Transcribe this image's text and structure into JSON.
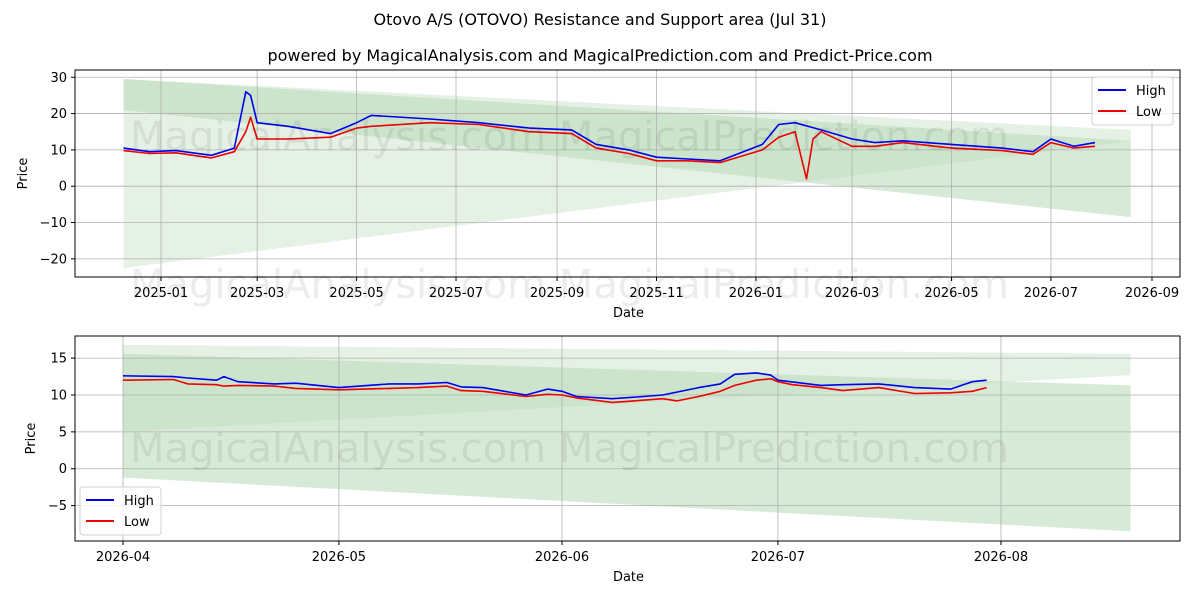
{
  "page": {
    "title": "Otovo A/S (OTOVO) Resistance and Support area (Jul 31)",
    "subtitle": "powered by MagicalAnalysis.com and MagicalPrediction.com and Predict-Price.com",
    "watermark_top": "MagicalAnalysis.com    MagicalPrediction.com",
    "watermark_middle": "MagicalAnalysis.com    MagicalPrediction.com",
    "watermark_bottom": "MagicalAnalysis.com    MagicalPrediction.com"
  },
  "colors": {
    "high": "#0000ee",
    "low": "#ee0000",
    "band_light": "#e3f0e3",
    "band_mid": "#cfe6cf",
    "band_dark": "#b6d9b6"
  },
  "chart_data": [
    {
      "type": "line",
      "xlabel": "Date",
      "ylabel": "Price",
      "x_ticks": [
        "2025-01",
        "2025-03",
        "2025-05",
        "2025-07",
        "2025-09",
        "2025-11",
        "2026-01",
        "2026-03",
        "2026-05",
        "2026-07",
        "2026-09"
      ],
      "y_ticks": [
        "30",
        "20",
        "10",
        "0",
        "−10",
        "−20"
      ],
      "ylim": [
        -25,
        32
      ],
      "grid": true,
      "legend": {
        "position": "top-right",
        "entries": [
          "High",
          "Low"
        ]
      },
      "bands": [
        {
          "name": "support-resistance-wide",
          "x_start": "2024-12-09",
          "x_end": "2026-08-19",
          "upper": [
            29.5,
            15.5
          ],
          "lower": [
            -22.5,
            12.5
          ]
        },
        {
          "name": "support-resistance-inner",
          "x_start": "2024-12-09",
          "x_end": "2026-08-19",
          "upper": [
            29.5,
            12.5
          ],
          "lower": [
            21.0,
            -8.5
          ]
        }
      ],
      "series": [
        {
          "name": "High",
          "x": [
            "2024-12-09",
            "2024-12-25",
            "2025-01-10",
            "2025-02-01",
            "2025-02-15",
            "2025-02-22",
            "2025-02-25",
            "2025-03-01",
            "2025-03-20",
            "2025-04-15",
            "2025-05-01",
            "2025-05-10",
            "2025-06-15",
            "2025-07-15",
            "2025-08-15",
            "2025-09-10",
            "2025-09-25",
            "2025-10-15",
            "2025-11-01",
            "2025-11-20",
            "2025-12-10",
            "2026-01-05",
            "2026-01-15",
            "2026-01-25",
            "2026-02-10",
            "2026-03-01",
            "2026-03-15",
            "2026-04-01",
            "2026-05-01",
            "2026-06-01",
            "2026-06-20",
            "2026-07-01",
            "2026-07-15",
            "2026-07-28"
          ],
          "y": [
            10.5,
            9.5,
            9.8,
            8.5,
            10.5,
            26.0,
            25.0,
            17.5,
            16.5,
            14.5,
            17.5,
            19.5,
            18.5,
            17.5,
            16.0,
            15.5,
            11.5,
            10.0,
            8.0,
            7.5,
            7.0,
            11.5,
            17.0,
            17.5,
            15.5,
            13.0,
            12.0,
            12.5,
            11.5,
            10.5,
            9.5,
            13.0,
            11.0,
            12.0
          ]
        },
        {
          "name": "Low",
          "x": [
            "2024-12-09",
            "2024-12-25",
            "2025-01-10",
            "2025-02-01",
            "2025-02-15",
            "2025-02-22",
            "2025-02-25",
            "2025-03-01",
            "2025-03-20",
            "2025-04-15",
            "2025-05-01",
            "2025-05-10",
            "2025-06-15",
            "2025-07-15",
            "2025-08-15",
            "2025-09-10",
            "2025-09-25",
            "2025-10-15",
            "2025-11-01",
            "2025-11-20",
            "2025-12-10",
            "2026-01-05",
            "2026-01-15",
            "2026-01-25",
            "2026-02-01",
            "2026-02-05",
            "2026-02-10",
            "2026-03-01",
            "2026-03-15",
            "2026-04-01",
            "2026-05-01",
            "2026-06-01",
            "2026-06-20",
            "2026-07-01",
            "2026-07-15",
            "2026-07-28"
          ],
          "y": [
            9.8,
            9.0,
            9.2,
            7.8,
            9.5,
            15.0,
            19.0,
            13.0,
            13.0,
            13.5,
            16.0,
            16.5,
            17.5,
            17.0,
            15.0,
            14.5,
            10.5,
            9.0,
            7.0,
            7.0,
            6.5,
            10.0,
            13.5,
            15.0,
            2.0,
            13.0,
            15.0,
            11.0,
            11.0,
            12.0,
            10.5,
            9.8,
            8.8,
            12.0,
            10.5,
            11.0
          ]
        }
      ]
    },
    {
      "type": "line",
      "xlabel": "Date",
      "ylabel": "Price",
      "x_ticks": [
        "2026-04",
        "2026-05",
        "2026-06",
        "2026-07",
        "2026-08"
      ],
      "y_ticks": [
        "15",
        "10",
        "5",
        "0",
        "−5"
      ],
      "ylim": [
        -9.8,
        18
      ],
      "grid": true,
      "legend": {
        "position": "bottom-left",
        "entries": [
          "High",
          "Low"
        ]
      },
      "bands": [
        {
          "name": "support-resistance-wide",
          "x_start": "2026-04-01",
          "x_end": "2026-08-19",
          "upper": [
            16.8,
            15.6
          ],
          "lower": [
            5.0,
            12.7
          ]
        },
        {
          "name": "support-resistance-inner",
          "x_start": "2026-04-01",
          "x_end": "2026-08-19",
          "upper": [
            15.6,
            11.3
          ],
          "lower": [
            -1.2,
            -8.5
          ]
        }
      ],
      "series": [
        {
          "name": "High",
          "x": [
            "2026-04-01",
            "2026-04-08",
            "2026-04-10",
            "2026-04-14",
            "2026-04-15",
            "2026-04-17",
            "2026-04-22",
            "2026-04-25",
            "2026-05-01",
            "2026-05-08",
            "2026-05-12",
            "2026-05-16",
            "2026-05-18",
            "2026-05-21",
            "2026-05-27",
            "2026-05-30",
            "2026-06-01",
            "2026-06-03",
            "2026-06-08",
            "2026-06-11",
            "2026-06-15",
            "2026-06-20",
            "2026-06-23",
            "2026-06-25",
            "2026-06-28",
            "2026-06-30",
            "2026-07-01",
            "2026-07-07",
            "2026-07-10",
            "2026-07-15",
            "2026-07-20",
            "2026-07-25",
            "2026-07-28",
            "2026-07-30"
          ],
          "y": [
            12.6,
            12.5,
            12.3,
            12.0,
            12.5,
            11.8,
            11.5,
            11.6,
            11.0,
            11.5,
            11.5,
            11.7,
            11.1,
            11.0,
            10.0,
            10.8,
            10.5,
            9.8,
            9.5,
            9.7,
            10.0,
            11.0,
            11.5,
            12.8,
            13.0,
            12.7,
            12.0,
            11.3,
            11.4,
            11.5,
            11.0,
            10.8,
            11.8,
            12.0
          ]
        },
        {
          "name": "Low",
          "x": [
            "2026-04-01",
            "2026-04-08",
            "2026-04-10",
            "2026-04-14",
            "2026-04-15",
            "2026-04-17",
            "2026-04-22",
            "2026-04-25",
            "2026-05-01",
            "2026-05-08",
            "2026-05-12",
            "2026-05-16",
            "2026-05-18",
            "2026-05-21",
            "2026-05-27",
            "2026-05-30",
            "2026-06-01",
            "2026-06-03",
            "2026-06-08",
            "2026-06-11",
            "2026-06-15",
            "2026-06-17",
            "2026-06-20",
            "2026-06-23",
            "2026-06-25",
            "2026-06-28",
            "2026-06-30",
            "2026-07-01",
            "2026-07-03",
            "2026-07-07",
            "2026-07-10",
            "2026-07-15",
            "2026-07-20",
            "2026-07-25",
            "2026-07-28",
            "2026-07-30"
          ],
          "y": [
            12.0,
            12.1,
            11.5,
            11.4,
            11.2,
            11.3,
            11.2,
            10.9,
            10.7,
            10.9,
            11.0,
            11.2,
            10.6,
            10.5,
            9.8,
            10.1,
            10.0,
            9.6,
            9.0,
            9.2,
            9.5,
            9.2,
            9.8,
            10.5,
            11.3,
            12.0,
            12.2,
            11.8,
            11.4,
            11.0,
            10.6,
            11.0,
            10.2,
            10.3,
            10.5,
            11.0
          ]
        }
      ]
    }
  ]
}
